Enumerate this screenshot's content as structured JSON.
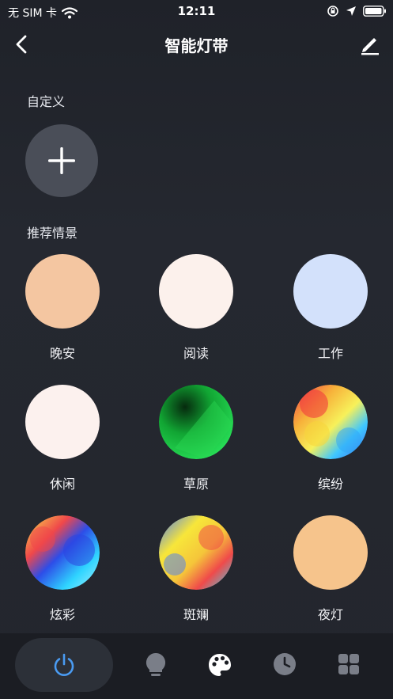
{
  "status_bar": {
    "carrier": "无 SIM 卡",
    "time": "12:11"
  },
  "header": {
    "title": "智能灯带",
    "back_icon": "chevron-left-icon",
    "edit_icon": "pencil-icon"
  },
  "custom_section": {
    "title": "自定义",
    "add_icon": "plus-icon"
  },
  "recommended_section": {
    "title": "推荐情景",
    "scenes": [
      {
        "label": "晚安",
        "color": "#f4c6a1"
      },
      {
        "label": "阅读",
        "color": "#fcf1ec"
      },
      {
        "label": "工作",
        "color": "#d3e1fb"
      },
      {
        "label": "休闲",
        "color": "#fcf1ee"
      },
      {
        "label": "草原",
        "color": "#1fd04a"
      },
      {
        "label": "缤纷",
        "color": "#f7c43a"
      },
      {
        "label": "炫彩",
        "color": "#3e7ff5"
      },
      {
        "label": "斑斓",
        "color": "#f6d531"
      },
      {
        "label": "夜灯",
        "color": "#f6c48c"
      }
    ]
  },
  "tab_bar": {
    "tabs": [
      {
        "name": "power",
        "icon": "power-icon",
        "active": true,
        "color": "#4a9bf2"
      },
      {
        "name": "bulb",
        "icon": "lightbulb-icon",
        "active": false
      },
      {
        "name": "palette",
        "icon": "palette-icon",
        "active": false
      },
      {
        "name": "timer",
        "icon": "clock-icon",
        "active": false
      },
      {
        "name": "more",
        "icon": "grid-icon",
        "active": false
      }
    ]
  }
}
